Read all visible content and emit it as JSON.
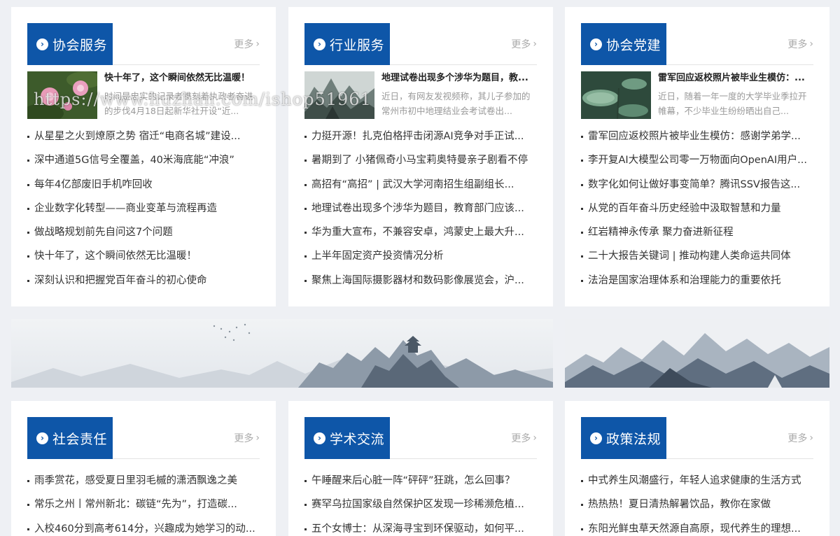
{
  "more_label": "更多",
  "watermark": "https://www.huzhan.com/ishop51961",
  "colors": {
    "accent": "#0e56a8",
    "page_bg": "#eef0f4"
  },
  "icons": {
    "tab": "chevron-circle-icon",
    "more": "chevron-right-icon"
  },
  "panels": [
    {
      "title": "协会服务",
      "featured": {
        "title": "快十年了，这个瞬间依然无比温暖！",
        "desc": "时间是忠实的记录者镌刻着执政者奋进的步伐4月18日起新华社开设“近..."
      },
      "items": [
        "从星星之火到燎原之势 宿迁“电商名城”建设...",
        "深中通道5G信号全覆盖，40米海底能“冲浪”",
        "每年4亿部废旧手机咋回收",
        "企业数字化转型——商业变革与流程再造",
        "做战略规划前先自问这7个问题",
        "快十年了，这个瞬间依然无比温暖！",
        "深刻认识和把握党百年奋斗的初心使命"
      ]
    },
    {
      "title": "行业服务",
      "featured": {
        "title": "地理试卷出现多个涉华为题目，教...",
        "desc": "近日，有网友发视频称，其儿子参加的常州市初中地理结业会考试卷出..."
      },
      "items": [
        "力挺开源！扎克伯格抨击闭源AI竞争对手正试...",
        "暑期到了 小猪佩奇小马宝莉奥特曼亲子剧看不停",
        "高招有“高招” | 武汉大学河南招生组副组长...",
        "地理试卷出现多个涉华为题目，教育部门应该...",
        "华为重大宣布，不兼容安卓，鸿蒙史上最大升...",
        "上半年固定资产投资情况分析",
        "聚焦上海国际摄影器材和数码影像展览会，沪..."
      ]
    },
    {
      "title": "协会党建",
      "featured": {
        "title": "雷军回应返校照片被毕业生模仿：...",
        "desc": "近日，随着一年一度的大学毕业季拉开帷幕，不少毕业生纷纷晒出自己..."
      },
      "items": [
        "雷军回应返校照片被毕业生模仿：感谢学弟学...",
        "李开复AI大模型公司零一万物面向OpenAI用户...",
        "数字化如何让做好事变简单？腾讯SSV报告这...",
        "从党的百年奋斗历史经验中汲取智慧和力量",
        "红岩精神永传承 聚力奋进新征程",
        "二十大报告关键词 | 推动构建人类命运共同体",
        "法治是国家治理体系和治理能力的重要依托"
      ]
    },
    {
      "title": "社会责任",
      "items": [
        "雨季赏花，感受夏日里羽毛槭的潇洒飘逸之美",
        "常乐之州丨常州新北：碳链“先为”，打造碳...",
        "入校460分到高考614分，兴趣成为她学习的动..."
      ]
    },
    {
      "title": "学术交流",
      "items": [
        "午睡醒来后心脏一阵“砰砰”狂跳，怎么回事？",
        "赛罕乌拉国家级自然保护区发现一珍稀濒危植...",
        "五个女博士：从深海寻宝到环保驱动，如何平..."
      ]
    },
    {
      "title": "政策法规",
      "items": [
        "中式养生风潮盛行，年轻人追求健康的生活方式",
        "热热热！夏日清热解暑饮品，教你在家做",
        "东阳光鲜虫草天然源自高原，现代养生的理想..."
      ]
    }
  ]
}
